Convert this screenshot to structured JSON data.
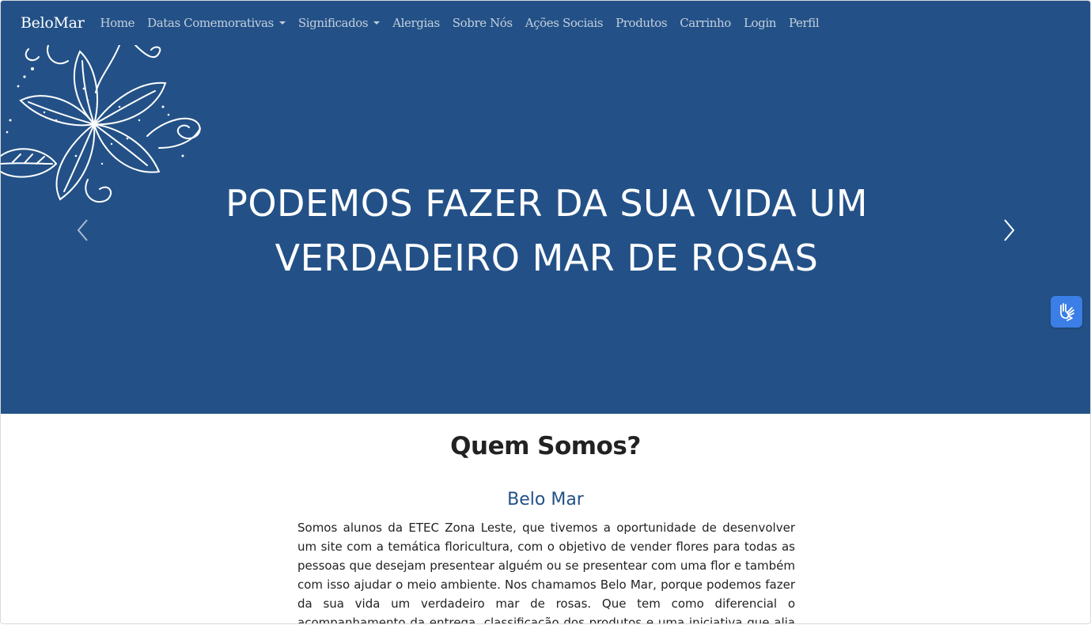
{
  "navbar": {
    "brand": "BeloMar",
    "links": [
      {
        "label": "Home"
      },
      {
        "label": "Datas Comemorativas"
      },
      {
        "label": "Significados"
      },
      {
        "label": "Alergias"
      },
      {
        "label": "Sobre Nós"
      },
      {
        "label": "Ações Sociais"
      },
      {
        "label": "Produtos"
      },
      {
        "label": "Carrinho"
      },
      {
        "label": "Login"
      },
      {
        "label": "Perfil"
      }
    ]
  },
  "carousel": {
    "line1": "PODEMOS FAZER DA SUA VIDA UM",
    "line2": "VERDADEIRO MAR DE ROSAS",
    "prev_icon": "chevron-left-icon",
    "next_icon": "chevron-right-icon"
  },
  "about": {
    "title": "Quem Somos?",
    "subtitle": "Belo Mar",
    "text": "Somos alunos da ETEC Zona Leste, que tivemos a oportunidade de desenvolver um site com a temática floricultura, com o objetivo de vender flores para todas as pessoas que desejam presentear alguém ou se presentear com uma flor e também com isso ajudar o meio ambiente. Nos chamamos Belo Mar, porque podemos fazer da sua vida um verdadeiro mar de rosas. Que tem como diferencial o acompanhamento da entrega, classificação dos produtos e uma iniciativa que alia a beleza das flores e a beleza da"
  },
  "accessibility": {
    "icon": "sign-language-hands-icon"
  },
  "colors": {
    "primary": "#235187",
    "accessibility_button": "#3a7ee6",
    "text": "#222222"
  }
}
